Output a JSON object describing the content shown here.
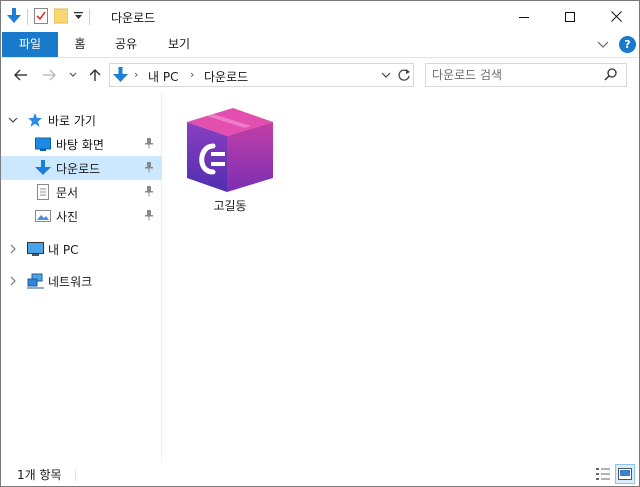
{
  "window": {
    "title": "다운로드"
  },
  "ribbon": {
    "tabs": [
      "파일",
      "홈",
      "공유",
      "보기"
    ],
    "help": "?"
  },
  "address": {
    "crumbs": [
      "내 PC",
      "다운로드"
    ],
    "separator": "›"
  },
  "search": {
    "placeholder": "다운로드 검색"
  },
  "navpane": {
    "quick_access": "바로 가기",
    "pinned": [
      "바탕 화면",
      "다운로드",
      "문서",
      "사진"
    ],
    "this_pc": "내 PC",
    "network": "네트워크"
  },
  "files": [
    {
      "name": "고길동",
      "icon": "winrar-archive-icon"
    }
  ],
  "status": {
    "item_count": "1개 항목"
  },
  "colors": {
    "accent": "#1979ca",
    "selection": "#cce8ff",
    "folder": "#f8d775"
  }
}
